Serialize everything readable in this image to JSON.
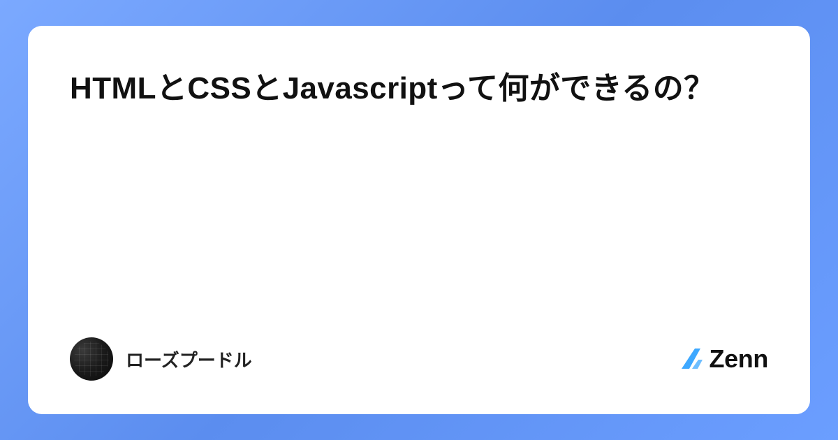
{
  "article": {
    "title": "HTMLとCSSとJavascriptって何ができるの？"
  },
  "author": {
    "name": "ローズプードル",
    "avatar_alt": "keyboard-avatar"
  },
  "brand": {
    "name": "Zenn",
    "accent_color": "#3ea8ff"
  }
}
